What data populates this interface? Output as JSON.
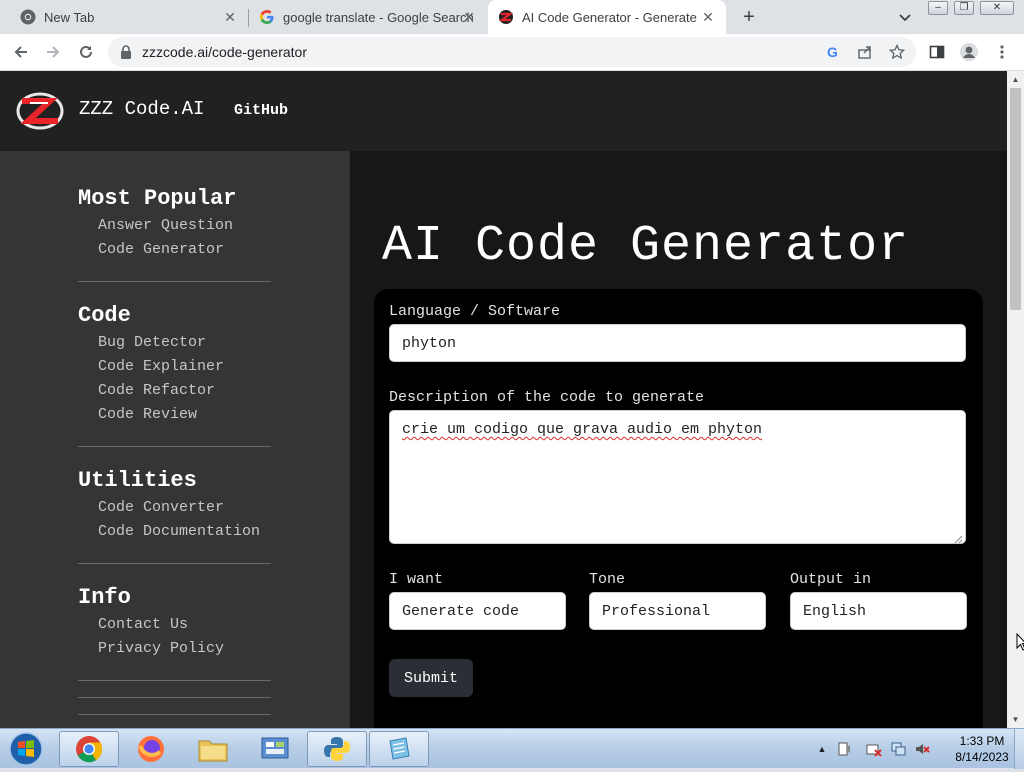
{
  "browser": {
    "tabs": [
      {
        "title": "New Tab",
        "icon": "chrome-icon",
        "active": false
      },
      {
        "title": "google translate - Google Search",
        "icon": "google-icon",
        "active": false
      },
      {
        "title": "AI Code Generator - Generate Co",
        "icon": "zzz-logo-icon",
        "active": true
      }
    ],
    "new_tab_label": "+",
    "close_label": "✕",
    "url": "zzzcode.ai/code-generator"
  },
  "site": {
    "name": "ZZZ Code.AI",
    "github": "GitHub"
  },
  "sidebar": {
    "sections": [
      {
        "heading": "Most Popular",
        "links": [
          "Answer Question",
          "Code Generator"
        ]
      },
      {
        "heading": "Code",
        "links": [
          "Bug Detector",
          "Code Explainer",
          "Code Refactor",
          "Code Review"
        ]
      },
      {
        "heading": "Utilities",
        "links": [
          "Code Converter",
          "Code Documentation"
        ]
      },
      {
        "heading": "Info",
        "links": [
          "Contact Us",
          "Privacy Policy"
        ]
      }
    ]
  },
  "main": {
    "title": "AI Code Generator",
    "form": {
      "language_label": "Language / Software",
      "language_value": "phyton",
      "description_label": "Description of the code to generate",
      "description_value": "crie um codigo que grava audio em phyton",
      "i_want_label": "I want",
      "i_want_value": "Generate code",
      "tone_label": "Tone",
      "tone_value": "Professional",
      "output_label": "Output in",
      "output_value": "English",
      "submit_label": "Submit"
    }
  },
  "taskbar": {
    "time": "1:33 PM",
    "date": "8/14/2023"
  },
  "colors": {
    "page_bg": "#171717",
    "header_bg": "#212121",
    "sidebar_bg": "#353535",
    "form_bg": "#000000",
    "submit_bg": "#2b2f35",
    "logo_red": "#e8242a"
  }
}
